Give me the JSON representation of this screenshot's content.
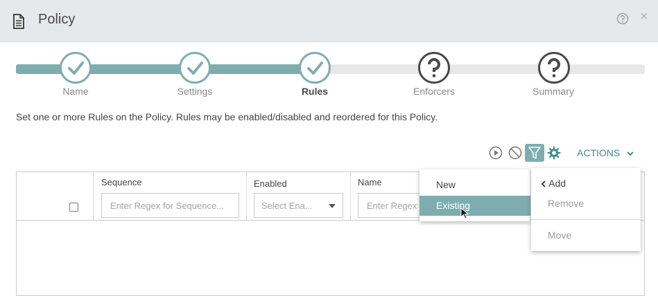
{
  "dialog": {
    "title": "Policy",
    "icons": {
      "document": "document-icon",
      "help": "help-icon",
      "close": "close-icon"
    },
    "close_glyph": "×"
  },
  "wizard": {
    "steps": [
      {
        "label": "Name",
        "state": "done"
      },
      {
        "label": "Settings",
        "state": "done"
      },
      {
        "label": "Rules",
        "state": "current"
      },
      {
        "label": "Enforcers",
        "state": "todo"
      },
      {
        "label": "Summary",
        "state": "todo"
      }
    ],
    "accent_color": "#7eadb0"
  },
  "description": "Set one or more Rules on the Policy. Rules may be enabled/disabled and reordered for this Policy.",
  "toolbar": {
    "icons": [
      "play-icon",
      "disable-icon",
      "filter-icon",
      "gear-icon"
    ],
    "actions_label": "ACTIONS"
  },
  "grid": {
    "columns": [
      {
        "label": "Sequence",
        "placeholder": "Enter Regex for Sequence..."
      },
      {
        "label": "Enabled",
        "placeholder": "Select Ena..."
      },
      {
        "label": "Name",
        "placeholder": "Enter Regex f"
      }
    ]
  },
  "add_menu": {
    "items": [
      "New",
      "Existing"
    ],
    "selected": "Existing"
  },
  "actions_menu": {
    "add": "Add",
    "remove": "Remove",
    "move": "Move"
  }
}
